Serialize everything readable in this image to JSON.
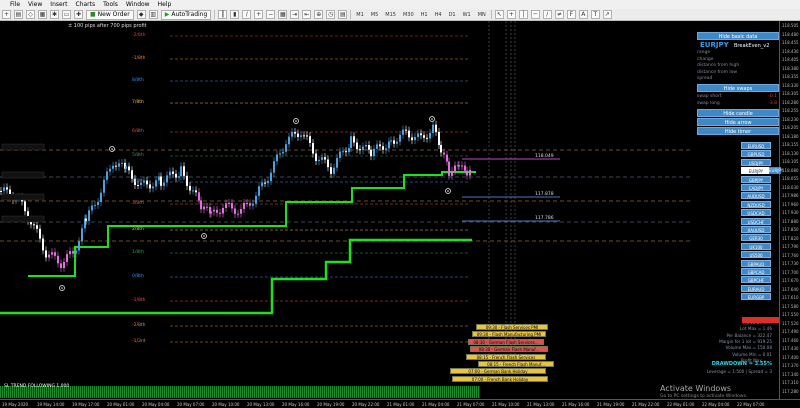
{
  "menu": [
    "File",
    "View",
    "Insert",
    "Charts",
    "Tools",
    "Window",
    "Help"
  ],
  "toolbar": {
    "new_order": "New Order",
    "autotrading": "AutoTrading",
    "timeframes": [
      "M1",
      "M5",
      "M15",
      "M30",
      "H1",
      "H4",
      "D1",
      "W1",
      "MN"
    ]
  },
  "chart": {
    "title": "± 100 pips after 700 pips profit",
    "indicator": "SL TREND FOLLOWING 1.000",
    "levels": [
      {
        "label": "-2/8th",
        "color": "#e0401a"
      },
      {
        "label": "-1/8th",
        "color": "#e8842b"
      },
      {
        "label": "8/8th",
        "color": "#3a8ee6"
      },
      {
        "label": "7/8th",
        "color": "#e8c63a"
      },
      {
        "label": "6/8th",
        "color": "#e05050"
      },
      {
        "label": "5/8th",
        "color": "#2fa14a"
      },
      {
        "label": "4/8th",
        "color": "#3a8ee6"
      },
      {
        "label": "3/8th",
        "color": "#e05050"
      },
      {
        "label": "2/8th",
        "color": "#e8c63a"
      },
      {
        "label": "1/8th",
        "color": "#2fa14a"
      },
      {
        "label": "0/8th",
        "color": "#3a8ee6"
      },
      {
        "label": "-1/8th",
        "color": "#e05050"
      },
      {
        "label": "-2/8th",
        "color": "#e8842b"
      },
      {
        "label": "-1/3rd",
        "color": "#e8842b"
      }
    ],
    "price_marks": [
      "118.049",
      "117.878",
      "117.786"
    ],
    "price_axis": [
      "118.505",
      "118.480",
      "118.455",
      "118.430",
      "118.405",
      "118.380",
      "118.355",
      "118.330",
      "118.305",
      "118.280",
      "118.255",
      "118.230",
      "118.205",
      "118.180",
      "118.155",
      "118.130",
      "118.105",
      "118.080",
      "118.055",
      "118.030",
      "117.986",
      "117.960",
      "117.930",
      "117.880",
      "117.850",
      "117.820",
      "117.790",
      "117.760",
      "117.730",
      "117.700",
      "117.670",
      "117.640",
      "117.610",
      "117.580",
      "117.550",
      "117.520",
      "117.490",
      "117.460",
      "117.430",
      "117.400",
      "117.370",
      "117.340",
      "117.310",
      "117.280"
    ],
    "time_axis": [
      "19 May 2020",
      "19 May 14:00",
      "19 May 17:00",
      "20 May 01:00",
      "20 May 04:00",
      "20 May 07:00",
      "20 May 10:00",
      "20 May 13:00",
      "20 May 16:00",
      "20 May 19:00",
      "20 May 22:00",
      "21 May 01:00",
      "21 May 04:00",
      "21 May 07:00",
      "21 May 10:00",
      "21 May 13:00",
      "21 May 16:00",
      "21 May 19:00",
      "21 May 22:00",
      "22 May 01:00",
      "22 May 04:00",
      "22 May 07:00"
    ]
  },
  "panel": {
    "title": "BreakEven_v2",
    "hide_basic": "Hide basic data",
    "symbol": "EURJPY",
    "rows": [
      {
        "label": "range"
      },
      {
        "label": "change"
      },
      {
        "label": "distance from high"
      },
      {
        "label": "distance from low"
      },
      {
        "label": "spread"
      }
    ],
    "hide_swaps": "Hide swaps",
    "swaps": [
      {
        "label": "swap short",
        "value": "-0.1"
      },
      {
        "label": "swap long",
        "value": "-3.8"
      }
    ],
    "hide_candle": "Hide candle",
    "hide_arrow": "Hide arrow",
    "hide_timer": "Hide timer",
    "symbols": [
      "EURUSD",
      "GBPUSD",
      "USDJPY",
      "EURJPY",
      "GBPJPY",
      "CADJPY",
      "AUDUSD",
      "NZDUSD",
      "USDCAD",
      "USDCHF",
      "XAUUSD",
      "GER30",
      "UK100",
      "US500",
      "GBPAUD",
      "GBPCAD",
      "GBPCHF",
      "EURAUD",
      "EURGBP"
    ],
    "active_symbol": "EURJPY"
  },
  "stats": [
    "Pip Value = ...",
    "Lot Max = 1.46",
    "Per Balance = 322.47",
    "Margin for 1 lot = 919.25",
    "Volume Max = 150.08",
    "Volume Min = 0.01",
    "Profit Max = ..."
  ],
  "drawdown": "DRAWDOWN = 3.55%",
  "leverage": "Leverage = 1:500 | Spread = 3",
  "news": [
    {
      "text": "09:30 - Flash Services PMI",
      "color": "#e8c63a"
    },
    {
      "text": "09:30 - Flash Manufacturing PMI",
      "color": "#e8c63a"
    },
    {
      "text": "08:30 - German Flash Services...",
      "color": "#e05050"
    },
    {
      "text": "08:30 - German Flash Manuf...",
      "color": "#e05050"
    },
    {
      "text": "08:15 - French Flash Services",
      "color": "#e8c63a"
    },
    {
      "text": "08:15 - French Flash Manuf...",
      "color": "#e8c63a"
    },
    {
      "text": "07:00 - German Bank Holiday",
      "color": "#e8c63a"
    },
    {
      "text": "07:00 - French Bank Holiday",
      "color": "#e8c63a"
    }
  ],
  "watermark": {
    "title": "Activate Windows",
    "sub": "Go to PC settings to activate Windows."
  }
}
